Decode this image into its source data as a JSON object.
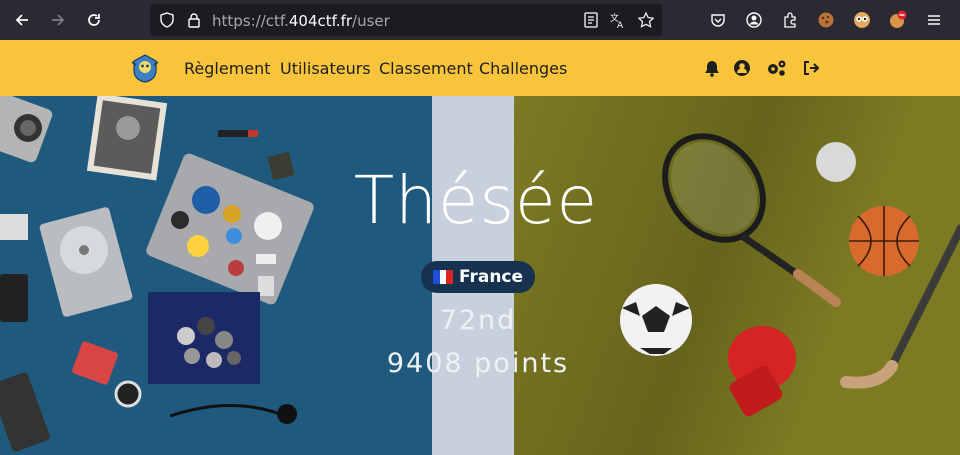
{
  "browser": {
    "url_scheme": "https://ctf.",
    "url_host": "404ctf.fr",
    "url_path": "/user",
    "icons": [
      "back-icon",
      "forward-icon",
      "reload-icon",
      "shield-icon",
      "lock-icon",
      "reader-view-icon",
      "translate-icon",
      "bookmark-star-icon",
      "pocket-icon",
      "account-icon",
      "extensions-icon",
      "cookie-extension-icon",
      "eyes-extension-icon",
      "blocker-extension-icon",
      "menu-icon"
    ]
  },
  "nav": {
    "links": [
      "Règlement",
      "Utilisateurs",
      "Classement",
      "Challenges"
    ],
    "icons": [
      "bell-icon",
      "user-icon",
      "settings-icon",
      "logout-icon"
    ],
    "colors": {
      "bar": "#f8c43c",
      "text": "#1e1e1e"
    }
  },
  "profile": {
    "team_name": "Thésée",
    "country": "France",
    "rank": "72nd",
    "points": "9408 points"
  },
  "colors": {
    "court_blue": "#1f5a7e",
    "court_green": "#7c7a22",
    "badge": "#16324f"
  }
}
